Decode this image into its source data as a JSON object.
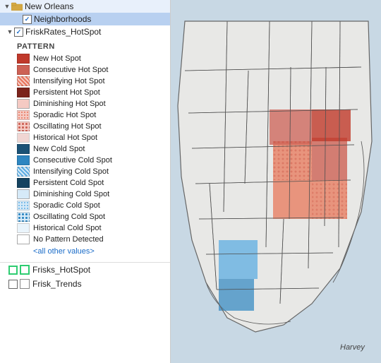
{
  "tree": {
    "root": {
      "label": "New Orleans",
      "toggle": "▼",
      "children": [
        {
          "id": "neighborhoods",
          "label": "Neighborhoods",
          "selected": true,
          "checked": true
        },
        {
          "id": "friskrates",
          "label": "FriskRates_HotSpot",
          "checked": true,
          "toggle": "▼"
        }
      ]
    },
    "pattern_header": "PATTERN",
    "legend": [
      {
        "id": "new-hot",
        "label": "New Hot Spot",
        "swatch": "new-hot"
      },
      {
        "id": "consecutive-hot",
        "label": "Consecutive Hot Spot",
        "swatch": "consecutive-hot"
      },
      {
        "id": "intensifying-hot",
        "label": "Intensifying Hot Spot",
        "swatch": "intensifying-hot"
      },
      {
        "id": "persistent-hot",
        "label": "Persistent Hot Spot",
        "swatch": "persistent-hot"
      },
      {
        "id": "diminishing-hot",
        "label": "Diminishing Hot Spot",
        "swatch": "diminishing-hot"
      },
      {
        "id": "sporadic-hot",
        "label": "Sporadic Hot Spot",
        "swatch": "sporadic-hot"
      },
      {
        "id": "oscillating-hot",
        "label": "Oscillating Hot Spot",
        "swatch": "oscillating-hot"
      },
      {
        "id": "historical-hot",
        "label": "Historical Hot Spot",
        "swatch": "historical-hot"
      },
      {
        "id": "new-cold",
        "label": "New Cold Spot",
        "swatch": "new-cold"
      },
      {
        "id": "consecutive-cold",
        "label": "Consecutive Cold Spot",
        "swatch": "consecutive-cold"
      },
      {
        "id": "intensifying-cold",
        "label": "Intensifying Cold Spot",
        "swatch": "intensifying-cold"
      },
      {
        "id": "persistent-cold",
        "label": "Persistent Cold Spot",
        "swatch": "persistent-cold"
      },
      {
        "id": "diminishing-cold",
        "label": "Diminishing Cold Spot",
        "swatch": "diminishing-cold"
      },
      {
        "id": "sporadic-cold",
        "label": "Sporadic Cold Spot",
        "swatch": "sporadic-cold"
      },
      {
        "id": "oscillating-cold",
        "label": "Oscillating Cold Spot",
        "swatch": "oscillating-cold"
      },
      {
        "id": "historical-cold",
        "label": "Historical Cold Spot",
        "swatch": "historical-cold"
      },
      {
        "id": "no-pattern",
        "label": "No Pattern Detected",
        "swatch": "no-pattern"
      }
    ],
    "all_other": "<all other values>",
    "bottom_layers": [
      {
        "id": "frisks-hotspot",
        "label": "Frisks_HotSpot",
        "icon": "green-square"
      },
      {
        "id": "frisk-trends",
        "label": "Frisk_Trends",
        "icon": "gray-square"
      }
    ]
  },
  "map": {
    "label": "Harvey"
  }
}
